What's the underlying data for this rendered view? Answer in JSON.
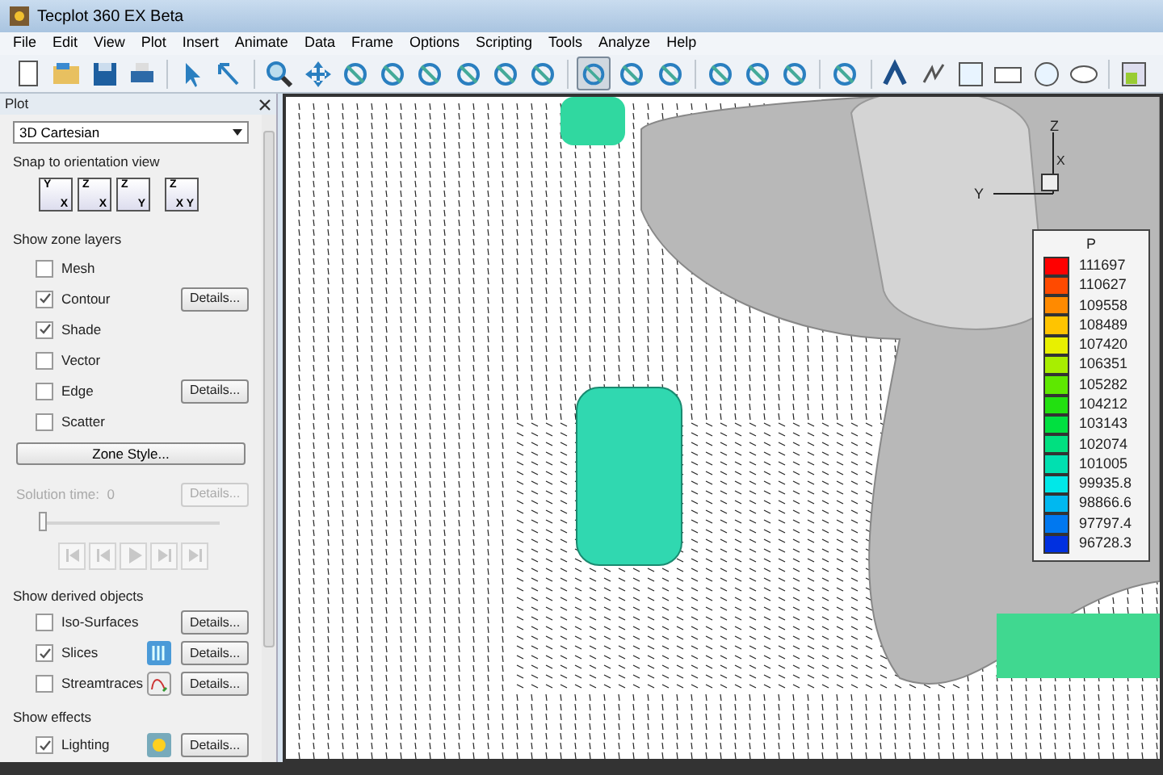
{
  "window": {
    "title": "Tecplot 360 EX Beta"
  },
  "menu": [
    "File",
    "Edit",
    "View",
    "Plot",
    "Insert",
    "Animate",
    "Data",
    "Frame",
    "Options",
    "Scripting",
    "Tools",
    "Analyze",
    "Help"
  ],
  "toolbar": {
    "buttons": [
      {
        "selected": false
      },
      {
        "selected": false
      },
      {
        "selected": false
      },
      {
        "selected": false
      },
      {
        "selected": false
      },
      {
        "selected": false
      },
      {
        "selected": false
      },
      {
        "selected": false
      },
      {
        "selected": false
      },
      {
        "selected": false
      },
      {
        "selected": false
      },
      {
        "selected": false
      },
      {
        "selected": false
      },
      {
        "selected": false
      },
      {
        "selected": true
      },
      {
        "selected": false
      },
      {
        "selected": false
      },
      {
        "selected": false
      },
      {
        "selected": false
      },
      {
        "selected": false
      },
      {
        "selected": false
      },
      {
        "selected": false
      },
      {
        "selected": false
      },
      {
        "selected": false
      },
      {
        "selected": false
      },
      {
        "selected": false
      },
      {
        "selected": false
      },
      {
        "selected": false
      }
    ]
  },
  "panel": {
    "title": "Plot",
    "plot_type": "3D Cartesian",
    "snap_label": "Snap to orientation view",
    "snap_buttons": [
      {
        "top": "Y",
        "bottom": "X"
      },
      {
        "top": "Z",
        "bottom": "X"
      },
      {
        "top": "Z",
        "bottom": "Y"
      },
      {
        "top": "Z",
        "bottom": "X Y"
      }
    ],
    "zone_layers_label": "Show zone layers",
    "zone_layers": [
      {
        "label": "Mesh",
        "checked": false
      },
      {
        "label": "Contour",
        "checked": true,
        "details": "Details..."
      },
      {
        "label": "Shade",
        "checked": true
      },
      {
        "label": "Vector",
        "checked": false
      },
      {
        "label": "Edge",
        "checked": false,
        "details": "Details..."
      },
      {
        "label": "Scatter",
        "checked": false
      }
    ],
    "zone_style": "Zone Style...",
    "solution_time": "Solution time:  0",
    "solution_details": "Details...",
    "time_slider": {
      "level": 0
    },
    "derived_label": "Show derived objects",
    "derived": [
      {
        "label": "Iso-Surfaces",
        "checked": false,
        "details": "Details..."
      },
      {
        "label": "Slices",
        "checked": true,
        "kind": "slices",
        "details": "Details..."
      },
      {
        "label": "Streamtraces",
        "checked": false,
        "kind": "streamtraces",
        "details": "Details..."
      }
    ],
    "effects_label": "Show effects",
    "effects": [
      {
        "label": "Lighting",
        "checked": true,
        "kind": "lighting",
        "details": "Details..."
      }
    ]
  },
  "view": {
    "axes": {
      "z": "Z",
      "y": "Y",
      "x": "X"
    },
    "legend": {
      "title": "P",
      "levels": [
        {
          "label": "111697",
          "color": "#ff0000"
        },
        {
          "label": "110627",
          "color": "#ff4a00"
        },
        {
          "label": "109558",
          "color": "#ff8a00"
        },
        {
          "label": "108489",
          "color": "#ffc400"
        },
        {
          "label": "107420",
          "color": "#e8f000"
        },
        {
          "label": "106351",
          "color": "#a8ee00"
        },
        {
          "label": "105282",
          "color": "#5ee800"
        },
        {
          "label": "104212",
          "color": "#22e010"
        },
        {
          "label": "103143",
          "color": "#00e040"
        },
        {
          "label": "102074",
          "color": "#00e080"
        },
        {
          "label": "101005",
          "color": "#00e0b0"
        },
        {
          "label": "99935.8",
          "color": "#00e8e8"
        },
        {
          "label": "98866.6",
          "color": "#00b8f0"
        },
        {
          "label": "97797.4",
          "color": "#0078f0"
        },
        {
          "label": "96728.3",
          "color": "#0030e0"
        }
      ]
    }
  }
}
